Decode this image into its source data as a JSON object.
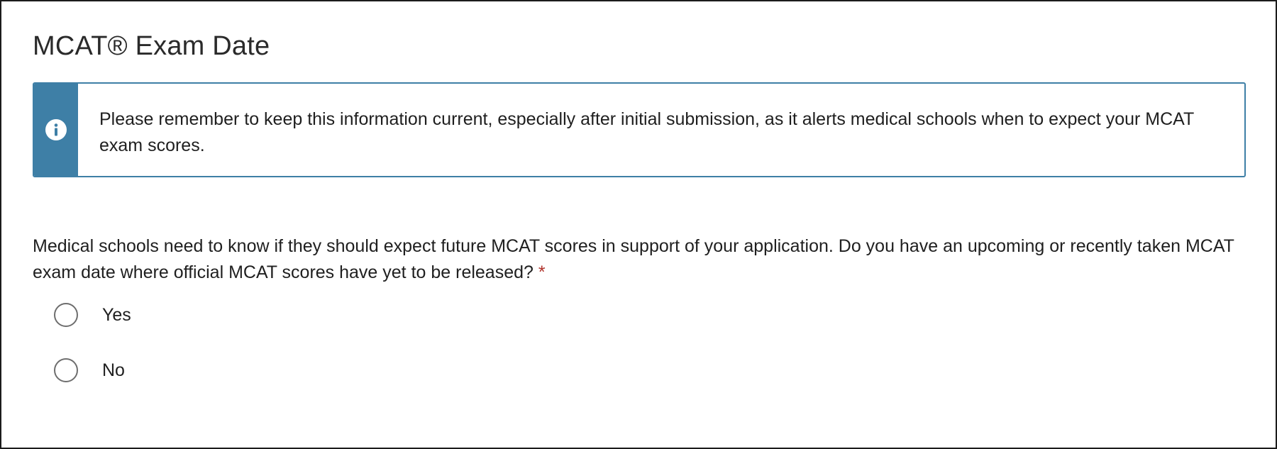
{
  "section": {
    "title": "MCAT® Exam Date"
  },
  "notice": {
    "icon": "info-icon",
    "accent_color": "#3e7fa6",
    "text": "Please remember to keep this information current, especially after initial submission, as it alerts medical schools when to expect your MCAT exam scores."
  },
  "question": {
    "text": "Medical schools need to know if they should expect future MCAT scores in support of your application. Do you have an upcoming or recently taken MCAT exam date where official MCAT scores have yet to be released?",
    "required_marker": "*",
    "required_color": "#b0322b",
    "options": [
      {
        "label": "Yes",
        "selected": false
      },
      {
        "label": "No",
        "selected": false
      }
    ]
  }
}
